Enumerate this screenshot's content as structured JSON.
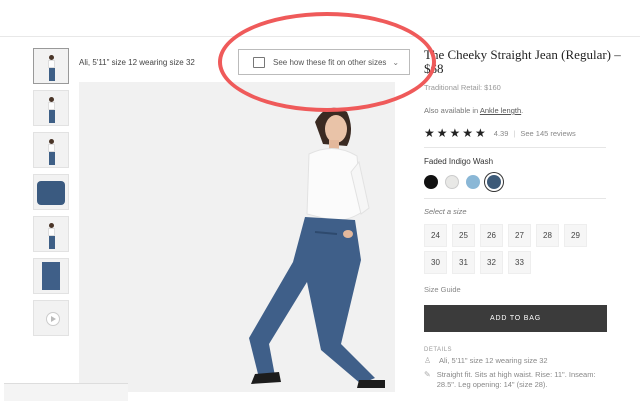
{
  "gallery": {
    "fit_note": "Ali, 5'11\" size 12 wearing size 32",
    "fit_button_label": "See how these fit on other sizes"
  },
  "product": {
    "title": "The Cheeky Straight Jean (Regular) – $68",
    "retail": "Traditional Retail: $160",
    "also_prefix": "Also available in",
    "also_link": "Ankle length",
    "also_suffix": ".",
    "rating_value": "4.39",
    "reviews_link": "See 145 reviews",
    "stars": "★★★★★",
    "color_name": "Faded Indigo Wash",
    "swatches": [
      "#111111",
      "#e8e8e6",
      "#8ab7d6",
      "#3d5a78"
    ],
    "select_size_label": "Select a size",
    "sizes": [
      "24",
      "25",
      "26",
      "27",
      "28",
      "29",
      "30",
      "31",
      "32",
      "33"
    ],
    "size_guide": "Size Guide",
    "add_to_bag": "ADD TO BAG",
    "details_heading": "DETAILS",
    "details": [
      "Ali, 5'11\" size 12 wearing size 32",
      "Straight fit. Sits at high waist. Rise: 11\". Inseam: 28.5\". Leg opening: 14\" (size 28)."
    ]
  }
}
